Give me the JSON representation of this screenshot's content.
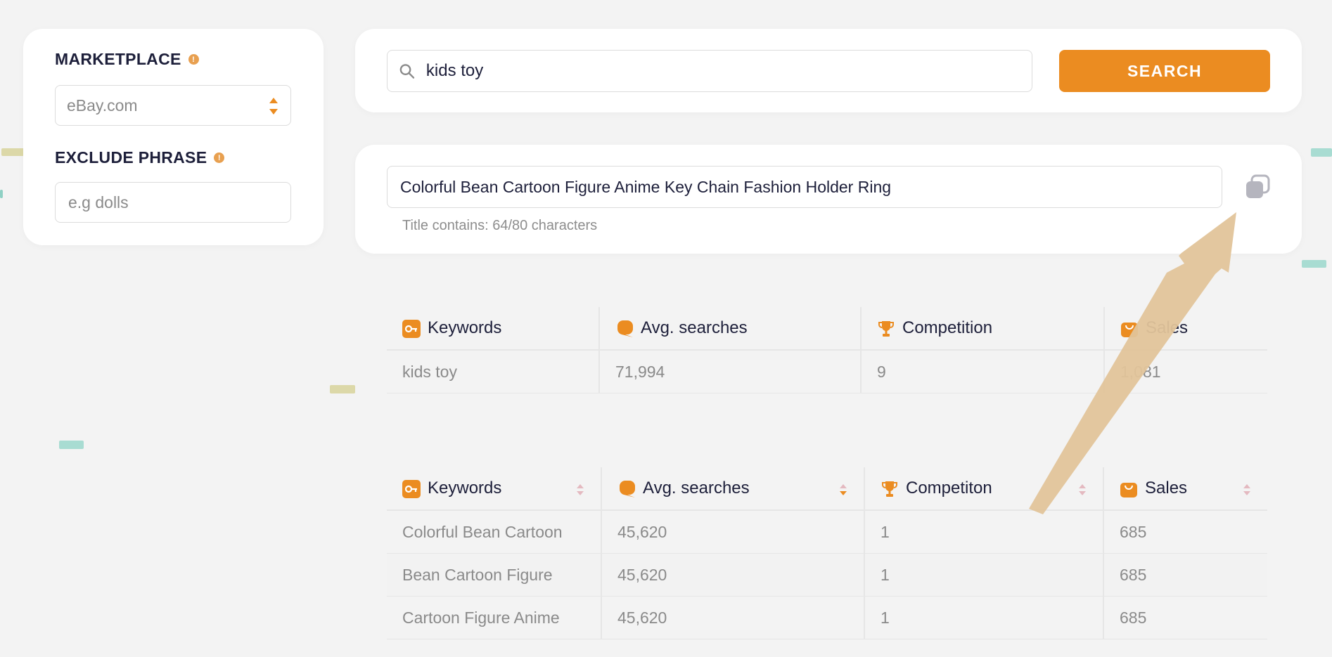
{
  "filters": {
    "marketplace_label": "MARKETPLACE",
    "marketplace_value": "eBay.com",
    "exclude_label": "EXCLUDE PHRASE",
    "exclude_placeholder": "e.g dolls"
  },
  "search": {
    "query": "kids toy",
    "button_label": "SEARCH"
  },
  "title_builder": {
    "title": "Colorful Bean Cartoon Figure Anime Key Chain Fashion Holder Ring",
    "char_count_text": "Title contains: 64/80 characters"
  },
  "summary_table": {
    "headers": [
      "Keywords",
      "Avg. searches",
      "Competition",
      "Sales"
    ],
    "row": [
      "kids toy",
      "71,994",
      "9",
      "1,081"
    ]
  },
  "keywords_table": {
    "headers": [
      "Keywords",
      "Avg. searches",
      "Competiton",
      "Sales"
    ],
    "rows": [
      [
        "Colorful Bean Cartoon",
        "45,620",
        "1",
        "685"
      ],
      [
        "Bean Cartoon Figure",
        "45,620",
        "1",
        "685"
      ],
      [
        "Cartoon Figure Anime",
        "45,620",
        "1",
        "685"
      ]
    ]
  },
  "colors": {
    "accent": "#eb8c21",
    "arrow": "#e2c49a",
    "background": "#f3f3f3"
  },
  "icons": {
    "keywords": "key-icon",
    "avg_searches": "speech-bubble-icon",
    "competition": "trophy-icon",
    "sales": "shopping-bag-icon",
    "copy": "copy-icon",
    "search": "search-icon"
  }
}
